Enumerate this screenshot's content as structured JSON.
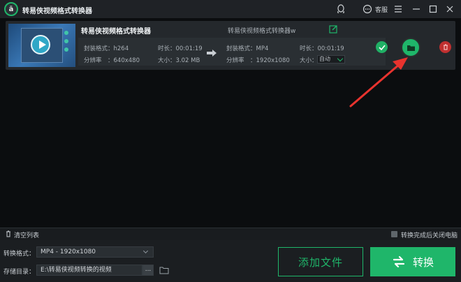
{
  "app": {
    "title": "转易侠视频格式转换器",
    "support_label": "客服"
  },
  "file": {
    "source_name": "转易侠视频格式转换器",
    "output_name": "转易侠视频格式转换器w",
    "source": {
      "codec_label": "封装格式：h264",
      "resolution_label": "分辨率　：640x480",
      "duration_label": "时长：00:01:19",
      "size_label": "大小：3.02 MB"
    },
    "output": {
      "codec_label": "封装格式：MP4",
      "resolution_label": "分辨率　：1920x1080",
      "duration_label": "时长：00:01:19",
      "size_label": "大小：",
      "size_value": "自动"
    }
  },
  "footer": {
    "clear_label": "清空列表",
    "shutdown_label": "转换完成后关闭电脑",
    "format_label": "转换格式：",
    "format_value": "MP4 - 1920x1080",
    "dir_label": "存储目录：",
    "dir_value": "E:\\转易侠视频转换的视频",
    "browse_label": "...",
    "add_label": "添加文件",
    "convert_label": "转换"
  },
  "colors": {
    "accent": "#1fb66a",
    "danger": "#c03030",
    "annotation": "#e8332e"
  }
}
